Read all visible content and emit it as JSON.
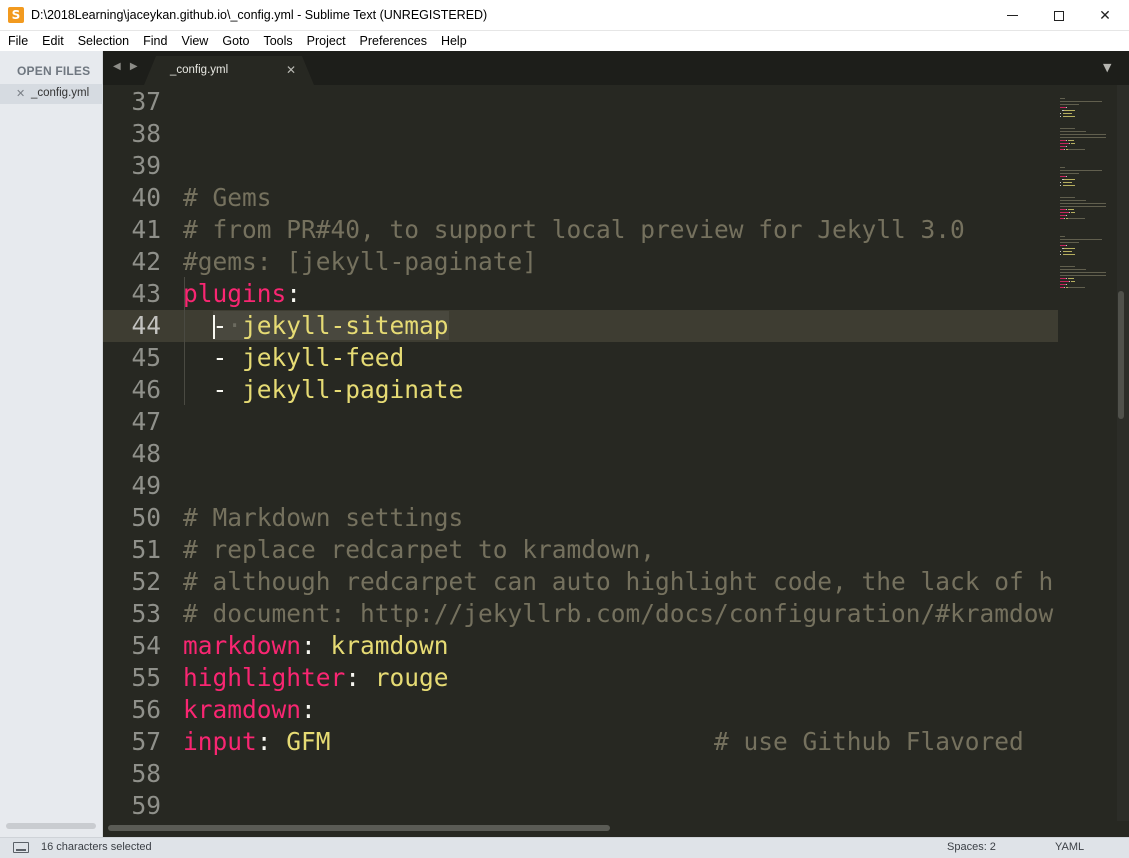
{
  "window": {
    "title": "D:\\2018Learning\\jaceykan.github.io\\_config.yml - Sublime Text (UNREGISTERED)",
    "app_icon": "sublime-text-icon",
    "minimize_glyph": "",
    "maximize_glyph": "",
    "close_glyph": "✕"
  },
  "menu": [
    "File",
    "Edit",
    "Selection",
    "Find",
    "View",
    "Goto",
    "Tools",
    "Project",
    "Preferences",
    "Help"
  ],
  "sidebar": {
    "header": "OPEN FILES",
    "files": [
      {
        "close": "✕",
        "name": "_config.yml"
      }
    ]
  },
  "tabs": {
    "nav": "◀ ▶",
    "items": [
      {
        "label": "_config.yml",
        "close": "✕"
      }
    ],
    "overflow": "▼"
  },
  "editor": {
    "current_line": 44,
    "lines": [
      {
        "num": "37",
        "tokens": []
      },
      {
        "num": "38",
        "tokens": []
      },
      {
        "num": "39",
        "tokens": []
      },
      {
        "num": "40",
        "tokens": [
          {
            "t": "# Gems",
            "c": "comment"
          }
        ]
      },
      {
        "num": "41",
        "tokens": [
          {
            "t": "# from PR#40, to support local preview for Jekyll 3.0",
            "c": "comment"
          }
        ]
      },
      {
        "num": "42",
        "tokens": [
          {
            "t": "#gems: [jekyll-paginate]",
            "c": "comment"
          }
        ]
      },
      {
        "num": "43",
        "tokens": [
          {
            "t": "plugins",
            "c": "key"
          },
          {
            "t": ":",
            "c": "plain"
          }
        ]
      },
      {
        "num": "44",
        "tokens": [
          {
            "t": "  ",
            "c": "plain"
          },
          {
            "t": "-",
            "c": "sel-plain"
          },
          {
            "t": "·",
            "c": "sel-dot"
          },
          {
            "t": "jekyll-sitemap",
            "c": "sel-str"
          }
        ]
      },
      {
        "num": "45",
        "tokens": [
          {
            "t": "  - ",
            "c": "plain"
          },
          {
            "t": "jekyll-feed",
            "c": "str"
          }
        ]
      },
      {
        "num": "46",
        "tokens": [
          {
            "t": "  - ",
            "c": "plain"
          },
          {
            "t": "jekyll-paginate",
            "c": "str"
          }
        ]
      },
      {
        "num": "47",
        "tokens": []
      },
      {
        "num": "48",
        "tokens": []
      },
      {
        "num": "49",
        "tokens": []
      },
      {
        "num": "50",
        "tokens": [
          {
            "t": "# Markdown settings",
            "c": "comment"
          }
        ]
      },
      {
        "num": "51",
        "tokens": [
          {
            "t": "# replace redcarpet to kramdown,",
            "c": "comment"
          }
        ]
      },
      {
        "num": "52",
        "tokens": [
          {
            "t": "# although redcarpet can auto highlight code, the lack of h",
            "c": "comment"
          }
        ]
      },
      {
        "num": "53",
        "tokens": [
          {
            "t": "# document: http://jekyllrb.com/docs/configuration/#kramdow",
            "c": "comment"
          }
        ]
      },
      {
        "num": "54",
        "tokens": [
          {
            "t": "markdown",
            "c": "key"
          },
          {
            "t": ": ",
            "c": "plain"
          },
          {
            "t": "kramdown",
            "c": "str"
          }
        ]
      },
      {
        "num": "55",
        "tokens": [
          {
            "t": "highlighter",
            "c": "key"
          },
          {
            "t": ": ",
            "c": "plain"
          },
          {
            "t": "rouge",
            "c": "str"
          }
        ]
      },
      {
        "num": "56",
        "tokens": [
          {
            "t": "kramdown",
            "c": "key"
          },
          {
            "t": ":",
            "c": "plain"
          }
        ]
      },
      {
        "num": "57",
        "tokens": [
          {
            "t": "input",
            "c": "key"
          },
          {
            "t": ": ",
            "c": "plain"
          },
          {
            "t": "GFM",
            "c": "str"
          },
          {
            "t": "                          # use Github Flavored",
            "c": "comment"
          }
        ]
      },
      {
        "num": "58",
        "tokens": []
      },
      {
        "num": "59",
        "tokens": []
      }
    ]
  },
  "status": {
    "selection": "16 characters selected",
    "spaces": "Spaces: 2",
    "syntax": "YAML"
  },
  "colors": {
    "editor_bg": "#272822",
    "comment": "#75715e",
    "keyword": "#f92672",
    "string": "#e6db74",
    "plain": "#f8f8f2"
  }
}
